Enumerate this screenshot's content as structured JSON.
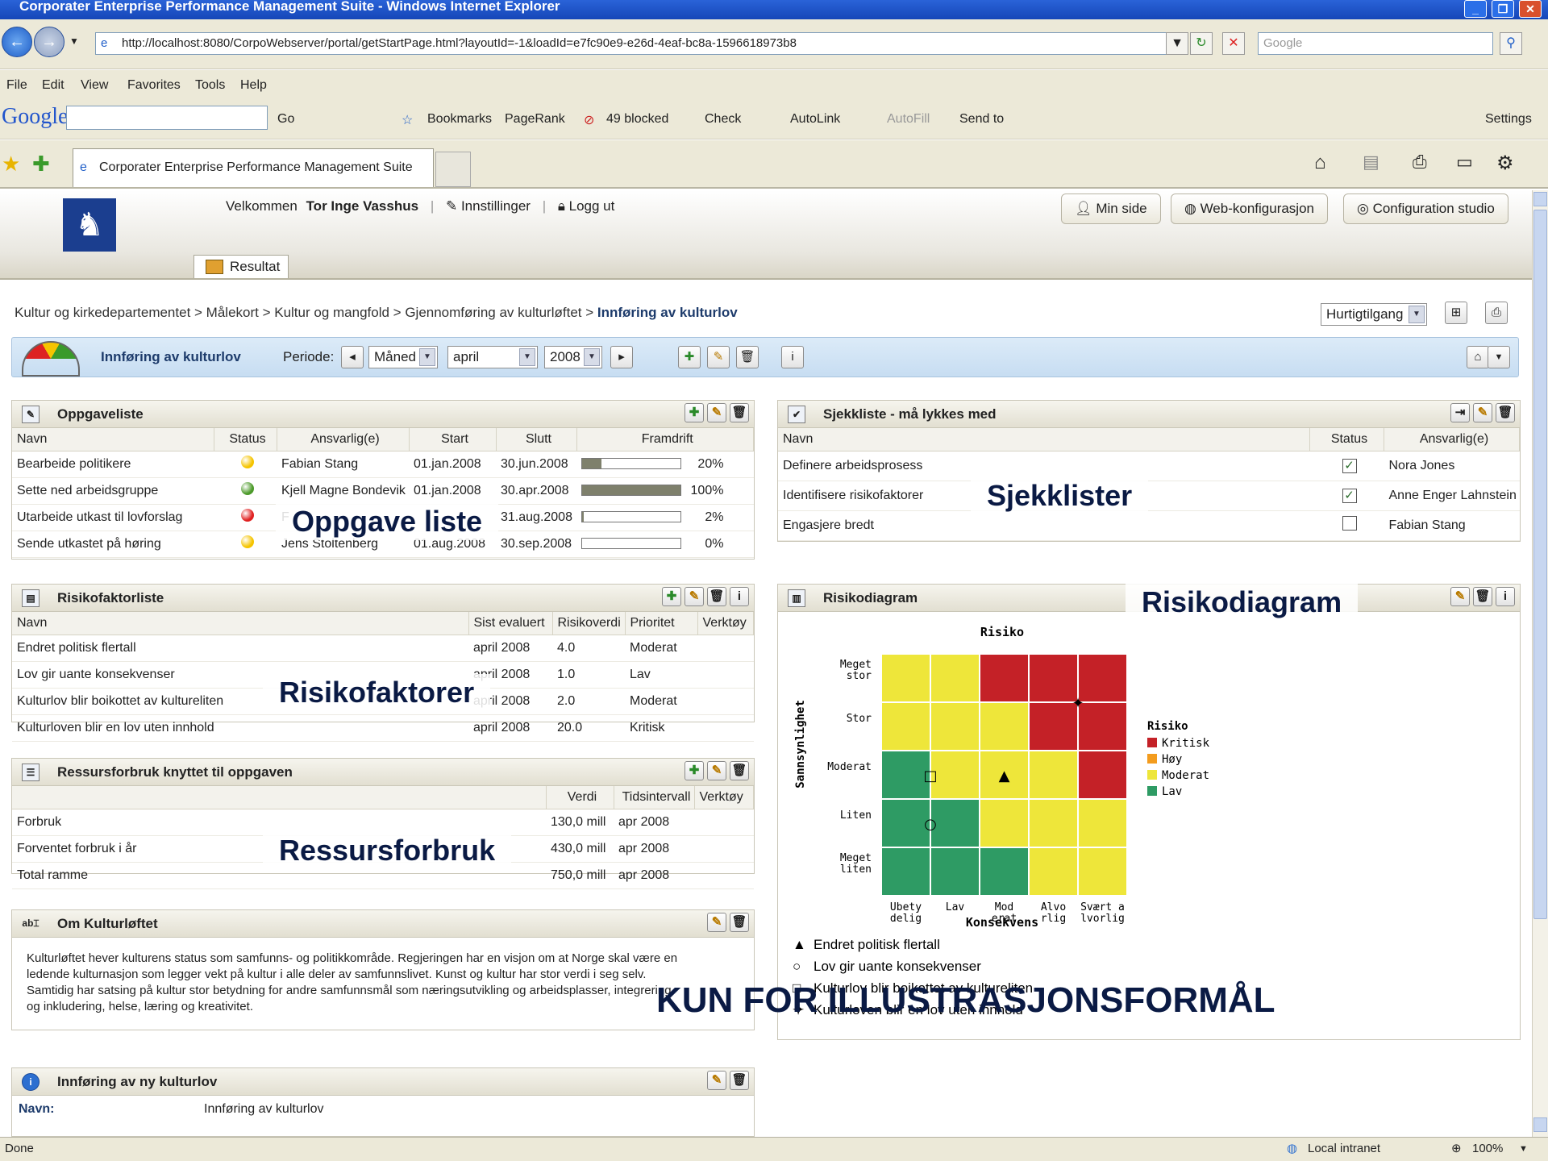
{
  "window": {
    "title": "Corporater Enterprise Performance Management Suite - Windows Internet Explorer"
  },
  "browser": {
    "url": "http://localhost:8080/CorpoWebserver/portal/getStartPage.html?layoutId=-1&loadId=e7fc90e9-e26d-4eaf-bc8a-1596618973b8",
    "search_placeholder": "Google",
    "menu": [
      "File",
      "Edit",
      "View",
      "Favorites",
      "Tools",
      "Help"
    ],
    "tab_title": "Corporater Enterprise Performance Management Suite",
    "google_toolbar": {
      "go": "Go",
      "bookmarks": "Bookmarks",
      "pagerank": "PageRank",
      "blocked": "49 blocked",
      "check": "Check",
      "autolink": "AutoLink",
      "autofill": "AutoFill",
      "sendto": "Send to",
      "settings": "Settings"
    }
  },
  "app": {
    "welcome": "Velkommen",
    "user": "Tor Inge Vasshus",
    "settings": "Innstillinger",
    "logout": "Logg ut",
    "buttons": [
      "Min side",
      "Web-konfigurasjon",
      "Configuration studio"
    ],
    "tab": "Resultat",
    "breadcrumb": [
      "Kultur og kirkedepartementet",
      "Målekort",
      "Kultur og mangfold",
      "Gjennomføring av kulturløftet",
      "Innføring av kulturlov"
    ],
    "quick_access": "Hurtigtilgang"
  },
  "toolbar": {
    "title": "Innføring av kulturlov",
    "period_label": "Periode:",
    "period_type": "Måned",
    "month": "april",
    "year": "2008"
  },
  "tasks": {
    "title": "Oppgaveliste",
    "columns": [
      "Navn",
      "Status",
      "Ansvarlig(e)",
      "Start",
      "Slutt",
      "Framdrift"
    ],
    "rows": [
      {
        "name": "Bearbeide politikere",
        "status": "#f5c400",
        "owner": "Fabian Stang",
        "start": "01.jan.2008",
        "end": "30.jun.2008",
        "progress": 20,
        "progress_label": "20%"
      },
      {
        "name": "Sette ned arbeidsgruppe",
        "status": "#4c9a2a",
        "owner": "Kjell Magne Bondevik",
        "start": "01.jan.2008",
        "end": "30.apr.2008",
        "progress": 100,
        "progress_label": "100%"
      },
      {
        "name": "Utarbeide utkast til lovforslag",
        "status": "#e02020",
        "owner": "F",
        "start": "",
        "end": "31.aug.2008",
        "progress": 2,
        "progress_label": "2%"
      },
      {
        "name": "Sende utkastet på høring",
        "status": "#f5c400",
        "owner": "Jens Stoltenberg",
        "start": "01.aug.2008",
        "end": "30.sep.2008",
        "progress": 0,
        "progress_label": "0%"
      }
    ]
  },
  "checklist": {
    "title": "Sjekkliste - må lykkes med",
    "columns": [
      "Navn",
      "Status",
      "Ansvarlig(e)"
    ],
    "rows": [
      {
        "name": "Definere arbeidsprosess",
        "checked": "✓",
        "owner": "Nora Jones"
      },
      {
        "name": "Identifisere risikofaktorer",
        "checked": "✓",
        "owner": "Anne Enger Lahnstein"
      },
      {
        "name": "Engasjere bredt",
        "checked": "",
        "owner": "Fabian Stang"
      }
    ]
  },
  "risks": {
    "title": "Risikofaktorliste",
    "columns": [
      "Navn",
      "Sist evaluert",
      "Risikoverdi",
      "Prioritet",
      "Verktøy"
    ],
    "rows": [
      {
        "name": "Endret politisk flertall",
        "evaluated": "april 2008",
        "value": "4.0",
        "priority": "Moderat"
      },
      {
        "name": "Lov gir uante konsekvenser",
        "evaluated": "april 2008",
        "value": "1.0",
        "priority": "Lav"
      },
      {
        "name": "Kulturlov blir boikottet av kultureliten",
        "evaluated": "april 2008",
        "value": "2.0",
        "priority": "Moderat"
      },
      {
        "name": "Kulturloven blir en lov uten innhold",
        "evaluated": "april 2008",
        "value": "20.0",
        "priority": "Kritisk"
      }
    ]
  },
  "resources": {
    "title": "Ressursforbruk knyttet til oppgaven",
    "columns": [
      "",
      "Verdi",
      "Tidsintervall",
      "Verktøy"
    ],
    "rows": [
      {
        "name": "Forbruk",
        "value": "130,0 mill",
        "interval": "apr 2008"
      },
      {
        "name": "Forventet forbruk i år",
        "value": "430,0 mill",
        "interval": "apr 2008"
      },
      {
        "name": "Total ramme",
        "value": "750,0 mill",
        "interval": "apr 2008"
      }
    ]
  },
  "about": {
    "title": "Om Kulturløftet",
    "lines": [
      "Kulturløftet hever kulturens status som samfunns- og politikkområde. Regjeringen har en visjon om at Norge skal være en",
      "ledende kulturnasjon som legger vekt på kultur i alle deler av samfunnslivet. Kunst og kultur har stor verdi i seg selv.",
      "Samtidig har satsing på kultur stor betydning for andre samfunnsmål som næringsutvikling og arbeidsplasser, integrering",
      "og inkludering, helse, læring og kreativitet."
    ]
  },
  "intro": {
    "title": "Innføring av ny kulturlov",
    "name_label": "Navn:",
    "name_value": "Innføring av kulturlov"
  },
  "riskdiagram": {
    "title": "Risikodiagram",
    "chart_title": "Risiko",
    "y_label": "Sannsynlighet",
    "x_label": "Konsekvens",
    "y_ticks": [
      "Meget stor",
      "Stor",
      "Moderat",
      "Liten",
      "Meget liten"
    ],
    "x_ticks": [
      "Ubety delig",
      "Lav",
      "Mod erat",
      "Alvo rlig",
      "Svært a lvorlig"
    ],
    "grid": [
      [
        "Y",
        "Y",
        "R",
        "R",
        "R"
      ],
      [
        "Y",
        "Y",
        "Y",
        "R",
        "R"
      ],
      [
        "G",
        "Y",
        "Y",
        "Y",
        "R"
      ],
      [
        "G",
        "G",
        "Y",
        "Y",
        "Y"
      ],
      [
        "G",
        "G",
        "G",
        "Y",
        "Y"
      ]
    ],
    "colors": {
      "R": "#c42127",
      "O": "#f39c1e",
      "Y": "#eee63a",
      "G": "#2e9b64"
    },
    "legend_title": "Risiko",
    "legend": [
      {
        "label": "Kritisk",
        "color": "#c42127"
      },
      {
        "label": "Høy",
        "color": "#f39c1e"
      },
      {
        "label": "Moderat",
        "color": "#eee63a"
      },
      {
        "label": "Lav",
        "color": "#2e9b64"
      }
    ],
    "markers": [
      {
        "symbol": "▲",
        "label": "Endret politisk flertall",
        "consequence": 3,
        "probability": 2.5
      },
      {
        "symbol": "○",
        "label": "Lov gir uante konsekvenser",
        "consequence": 1.5,
        "probability": 1.5
      },
      {
        "symbol": "□",
        "label": "Kulturlov blir boikottet av kultureliten",
        "consequence": 1.5,
        "probability": 2.5
      },
      {
        "symbol": "✦",
        "label": "Kulturloven blir en lov uten innhold",
        "consequence": 4.5,
        "probability": 4.0
      }
    ]
  },
  "overlays": {
    "tasks": "Oppgave liste",
    "checklist": "Sjekklister",
    "risks": "Risikofaktorer",
    "diagram": "Risikodiagram",
    "resources": "Ressursforbruk",
    "watermark": "KUN FOR ILLUSTRASJONSFORMÅL"
  },
  "status": {
    "left": "Done",
    "zone": "Local intranet",
    "zoom": "100%"
  }
}
